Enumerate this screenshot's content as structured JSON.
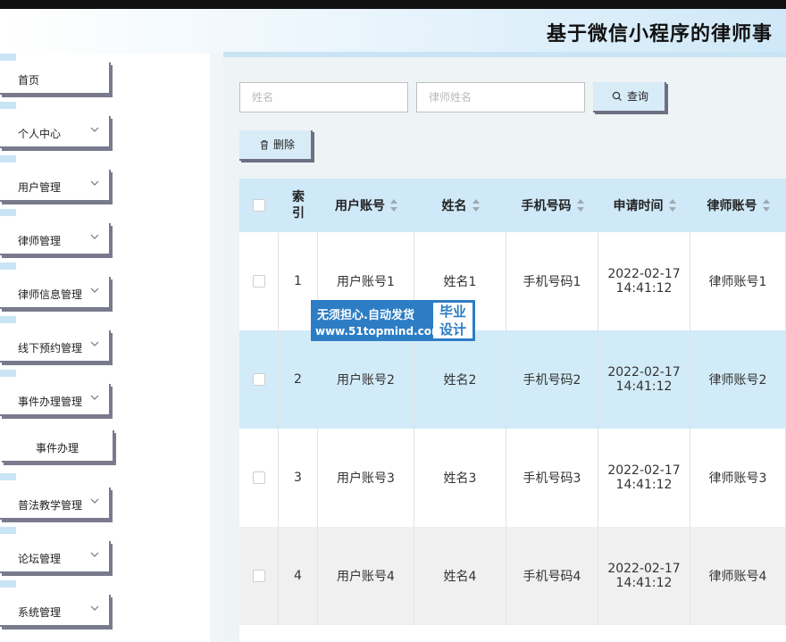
{
  "header": {
    "title": "基于微信小程序的律师事"
  },
  "sidebar": {
    "items": [
      {
        "label": "首页",
        "dropdown": false
      },
      {
        "label": "个人中心",
        "dropdown": true
      },
      {
        "label": "用户管理",
        "dropdown": true
      },
      {
        "label": "律师管理",
        "dropdown": true
      },
      {
        "label": "律师信息管理",
        "dropdown": true
      },
      {
        "label": "线下预约管理",
        "dropdown": true
      },
      {
        "label": "事件办理管理",
        "dropdown": true
      },
      {
        "label": "事件办理",
        "dropdown": false,
        "sub": true
      },
      {
        "label": "普法教学管理",
        "dropdown": true
      },
      {
        "label": "论坛管理",
        "dropdown": true
      },
      {
        "label": "系统管理",
        "dropdown": true
      }
    ]
  },
  "search": {
    "name_placeholder": "姓名",
    "lawyer_name_placeholder": "律师姓名",
    "query_label": "查询",
    "delete_label": "删除"
  },
  "table": {
    "headers": [
      "索引",
      "用户账号",
      "姓名",
      "手机号码",
      "申请时间",
      "律师账号"
    ],
    "rows": [
      {
        "index": "1",
        "account": "用户账号1",
        "name": "姓名1",
        "phone": "手机号码1",
        "date": "2022-02-17",
        "time": "14:41:12",
        "lawyer": "律师账号1"
      },
      {
        "index": "2",
        "account": "用户账号2",
        "name": "姓名2",
        "phone": "手机号码2",
        "date": "2022-02-17",
        "time": "14:41:12",
        "lawyer": "律师账号2"
      },
      {
        "index": "3",
        "account": "用户账号3",
        "name": "姓名3",
        "phone": "手机号码3",
        "date": "2022-02-17",
        "time": "14:41:12",
        "lawyer": "律师账号3"
      },
      {
        "index": "4",
        "account": "用户账号4",
        "name": "姓名4",
        "phone": "手机号码4",
        "date": "2022-02-17",
        "time": "14:41:12",
        "lawyer": "律师账号4"
      }
    ]
  },
  "watermark": {
    "line1": "无须担心.自动发货",
    "line2": "www.51topmind.com",
    "badge1": "毕业",
    "badge2": "设计"
  },
  "colors": {
    "accent": "#cfe9f8",
    "highlight_row": "#d2ebf8",
    "watermark": "#2c7dc4"
  }
}
